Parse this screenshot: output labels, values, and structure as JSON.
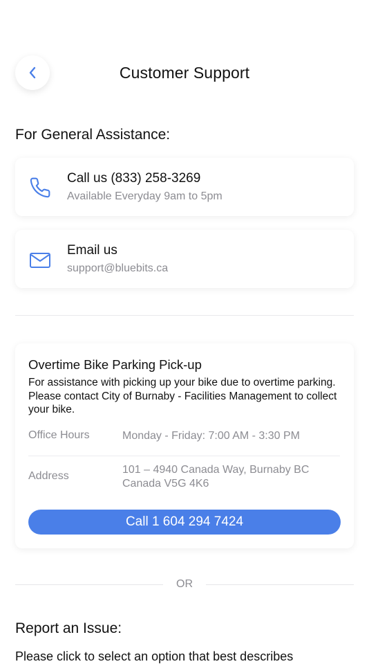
{
  "header": {
    "title": "Customer Support",
    "back_icon": "chevron-left-icon"
  },
  "general": {
    "heading": "For General Assistance:",
    "call": {
      "title": "Call us (833) 258-3269",
      "subtitle": "Available Everyday 9am to 5pm",
      "icon": "phone-icon"
    },
    "email": {
      "title": "Email us",
      "subtitle": "support@bluebits.ca",
      "icon": "mail-icon"
    }
  },
  "overtime": {
    "title": "Overtime Bike Parking Pick-up",
    "description": "For assistance with picking up your bike due to overtime parking. Please contact City of Burnaby - Facilities Management to collect your bike.",
    "office_hours_label": "Office Hours",
    "office_hours_value": "Monday - Friday: 7:00 AM - 3:30 PM",
    "address_label": "Address",
    "address_line1": "101 – 4940 Canada Way, Burnaby BC",
    "address_line2": "Canada V5G 4K6",
    "call_button": "Call 1 604 294 7424"
  },
  "separator": {
    "or": "OR"
  },
  "report": {
    "heading": "Report an Issue:",
    "description": "Please click to select an option that best describes"
  },
  "colors": {
    "accent": "#4a7fe8",
    "muted_text": "#8c8c92",
    "background": "#ffffff"
  }
}
